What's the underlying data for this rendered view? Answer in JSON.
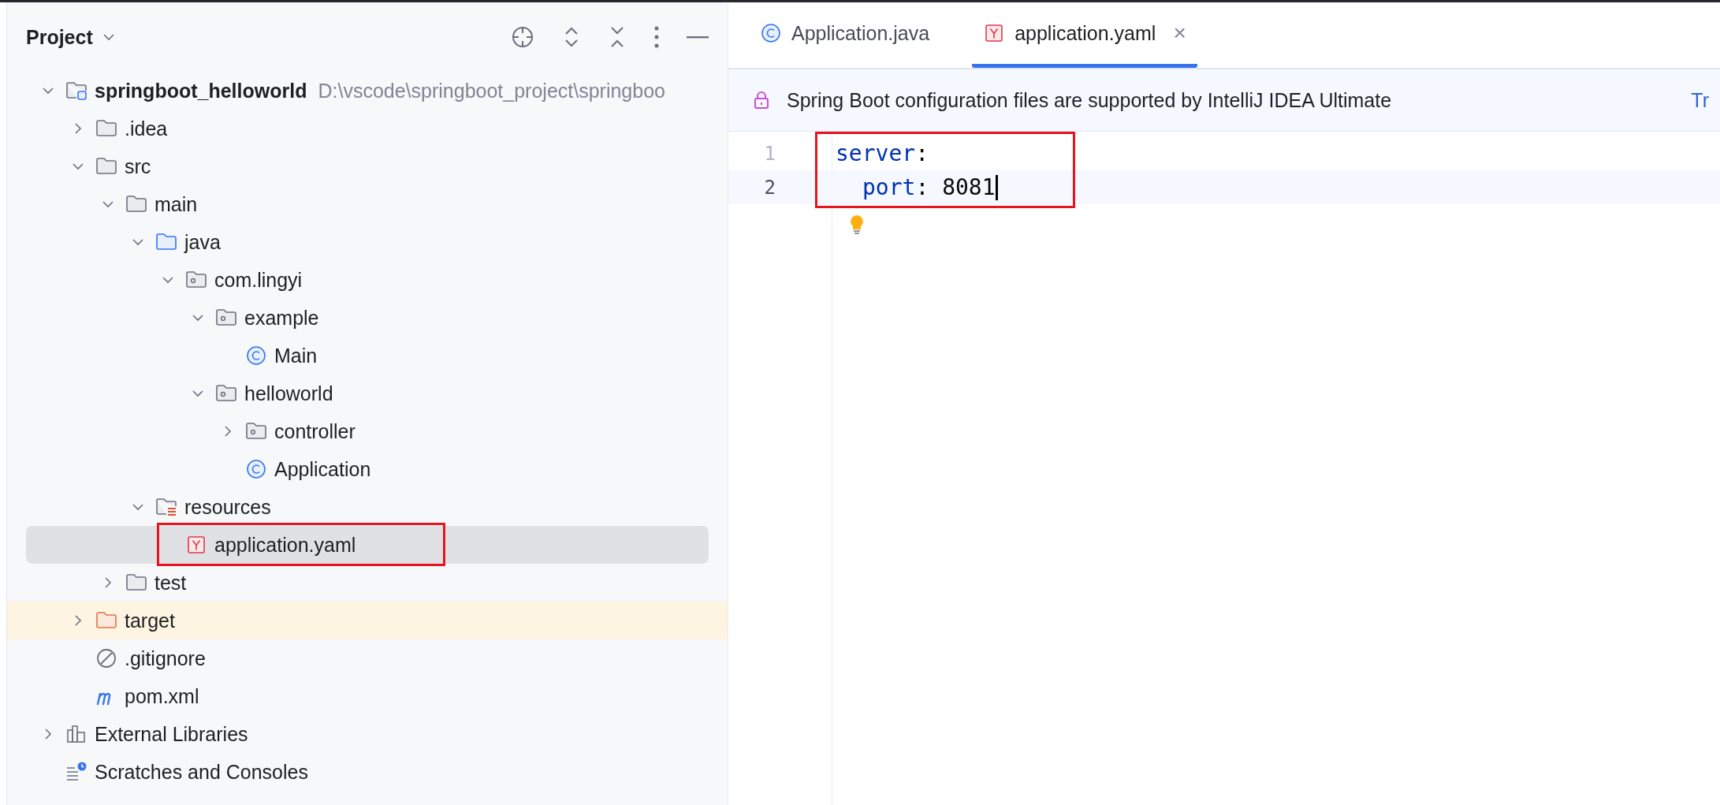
{
  "project_panel": {
    "title": "Project",
    "tree": [
      {
        "label": "springboot_helloworld",
        "path": "D:\\vscode\\springboot_project\\springboo",
        "kind": "module",
        "expanded": true,
        "selected": false,
        "children": [
          {
            "label": ".idea",
            "kind": "folder",
            "expanded": false,
            "selected": false
          },
          {
            "label": "src",
            "kind": "folder",
            "expanded": true,
            "selected": false,
            "children": [
              {
                "label": "main",
                "kind": "folder",
                "expanded": true,
                "selected": false,
                "children": [
                  {
                    "label": "java",
                    "kind": "source-folder",
                    "expanded": true,
                    "selected": false,
                    "children": [
                      {
                        "label": "com.lingyi",
                        "kind": "package",
                        "expanded": true,
                        "selected": false,
                        "children": [
                          {
                            "label": "example",
                            "kind": "package",
                            "expanded": true,
                            "selected": false,
                            "children": [
                              {
                                "label": "Main",
                                "kind": "class",
                                "selected": false
                              }
                            ]
                          },
                          {
                            "label": "helloworld",
                            "kind": "package",
                            "expanded": true,
                            "selected": false,
                            "children": [
                              {
                                "label": "controller",
                                "kind": "package",
                                "expanded": false,
                                "selected": false
                              },
                              {
                                "label": "Application",
                                "kind": "class",
                                "selected": false
                              }
                            ]
                          }
                        ]
                      }
                    ]
                  },
                  {
                    "label": "resources",
                    "kind": "resources-folder",
                    "expanded": true,
                    "selected": false,
                    "children": [
                      {
                        "label": "application.yaml",
                        "kind": "yaml",
                        "selected": true,
                        "annotated": true
                      }
                    ]
                  }
                ]
              },
              {
                "label": "test",
                "kind": "folder",
                "expanded": false,
                "selected": false
              }
            ]
          },
          {
            "label": "target",
            "kind": "excluded-folder",
            "expanded": false,
            "selected": false
          },
          {
            "label": ".gitignore",
            "kind": "gitignore",
            "selected": false
          },
          {
            "label": "pom.xml",
            "kind": "maven",
            "selected": false
          }
        ]
      },
      {
        "label": "External Libraries",
        "kind": "libraries",
        "expanded": false,
        "selected": false
      },
      {
        "label": "Scratches and Consoles",
        "kind": "scratches",
        "selected": false
      }
    ]
  },
  "editor": {
    "tabs": [
      {
        "label": "Application.java",
        "kind": "class",
        "selected": false
      },
      {
        "label": "application.yaml",
        "kind": "yaml",
        "selected": true,
        "close": "×"
      }
    ],
    "banner": {
      "message": "Spring Boot configuration files are supported by IntelliJ IDEA Ultimate",
      "link": "Tr"
    },
    "annotated": true,
    "lines": [
      {
        "number": "1",
        "current": false,
        "tokens": [
          {
            "kind": "key",
            "text": "server"
          },
          {
            "kind": "punct",
            "text": ":"
          }
        ]
      },
      {
        "number": "2",
        "current": true,
        "indented": true,
        "tokens": [
          {
            "kind": "key",
            "text": "port"
          },
          {
            "kind": "punct",
            "text": ":"
          },
          {
            "kind": "value",
            "text": " 8081"
          }
        ]
      }
    ]
  }
}
